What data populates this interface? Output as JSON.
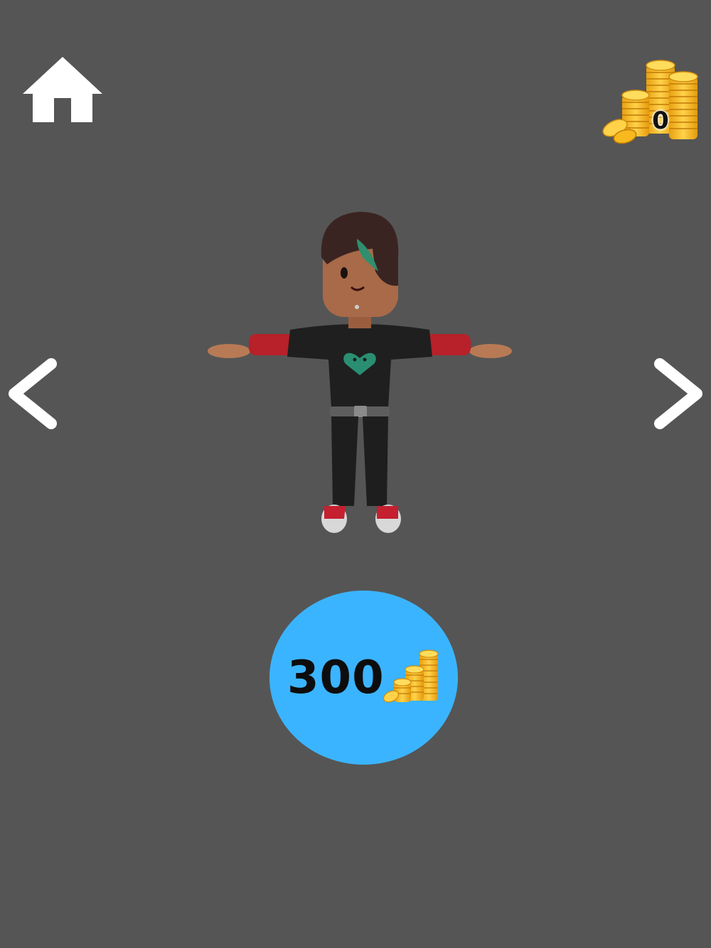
{
  "header": {
    "home_icon": "home-icon",
    "coin_balance": "0",
    "coin_icon": "coin-stack-icon"
  },
  "navigation": {
    "prev_icon": "chevron-left-icon",
    "next_icon": "chevron-right-icon"
  },
  "character": {
    "icon": "character-avatar"
  },
  "purchase": {
    "price": "300",
    "currency_icon": "coin-stack-icon",
    "button_color": "#3bb4ff"
  },
  "colors": {
    "background": "#555555",
    "accent_blue": "#3bb4ff",
    "coin_gold": "#f7b91e"
  }
}
